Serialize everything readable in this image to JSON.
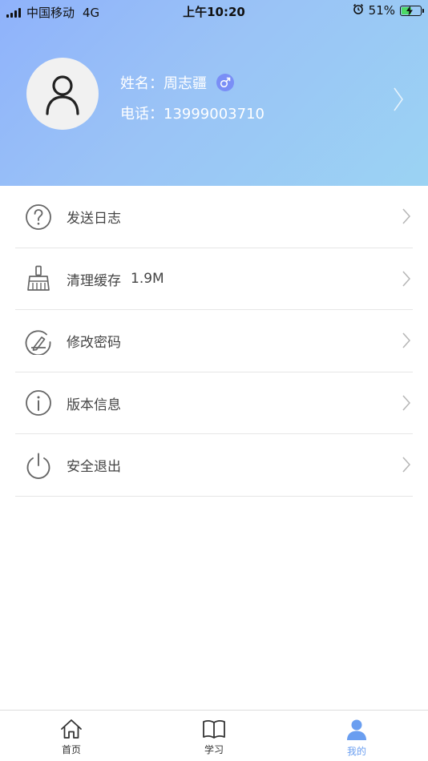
{
  "status_bar": {
    "carrier": "中国移动",
    "network": "4G",
    "time": "上午10:20",
    "battery": "51%",
    "battery_level": 0.51
  },
  "profile": {
    "name_line": "姓名：周志疆",
    "phone_line": "电话：13999003710",
    "gender_icon": "male-symbol-icon",
    "accent_color": "#7a8ef6"
  },
  "menu": {
    "items": [
      {
        "label": "发送日志",
        "value": "",
        "icon": "question-circle-icon"
      },
      {
        "label": "清理缓存",
        "value": "1.9M",
        "icon": "broom-icon"
      },
      {
        "label": "修改密码",
        "value": "",
        "icon": "edit-pen-circle-icon"
      },
      {
        "label": "版本信息",
        "value": "",
        "icon": "info-circle-icon"
      },
      {
        "label": "安全退出",
        "value": "",
        "icon": "power-icon"
      }
    ]
  },
  "tabbar": {
    "tabs": [
      {
        "label": "首页",
        "icon": "home-icon",
        "active": false
      },
      {
        "label": "学习",
        "icon": "book-icon",
        "active": false
      },
      {
        "label": "我的",
        "icon": "person-icon",
        "active": true
      }
    ],
    "active_color": "#6a9ef0"
  }
}
